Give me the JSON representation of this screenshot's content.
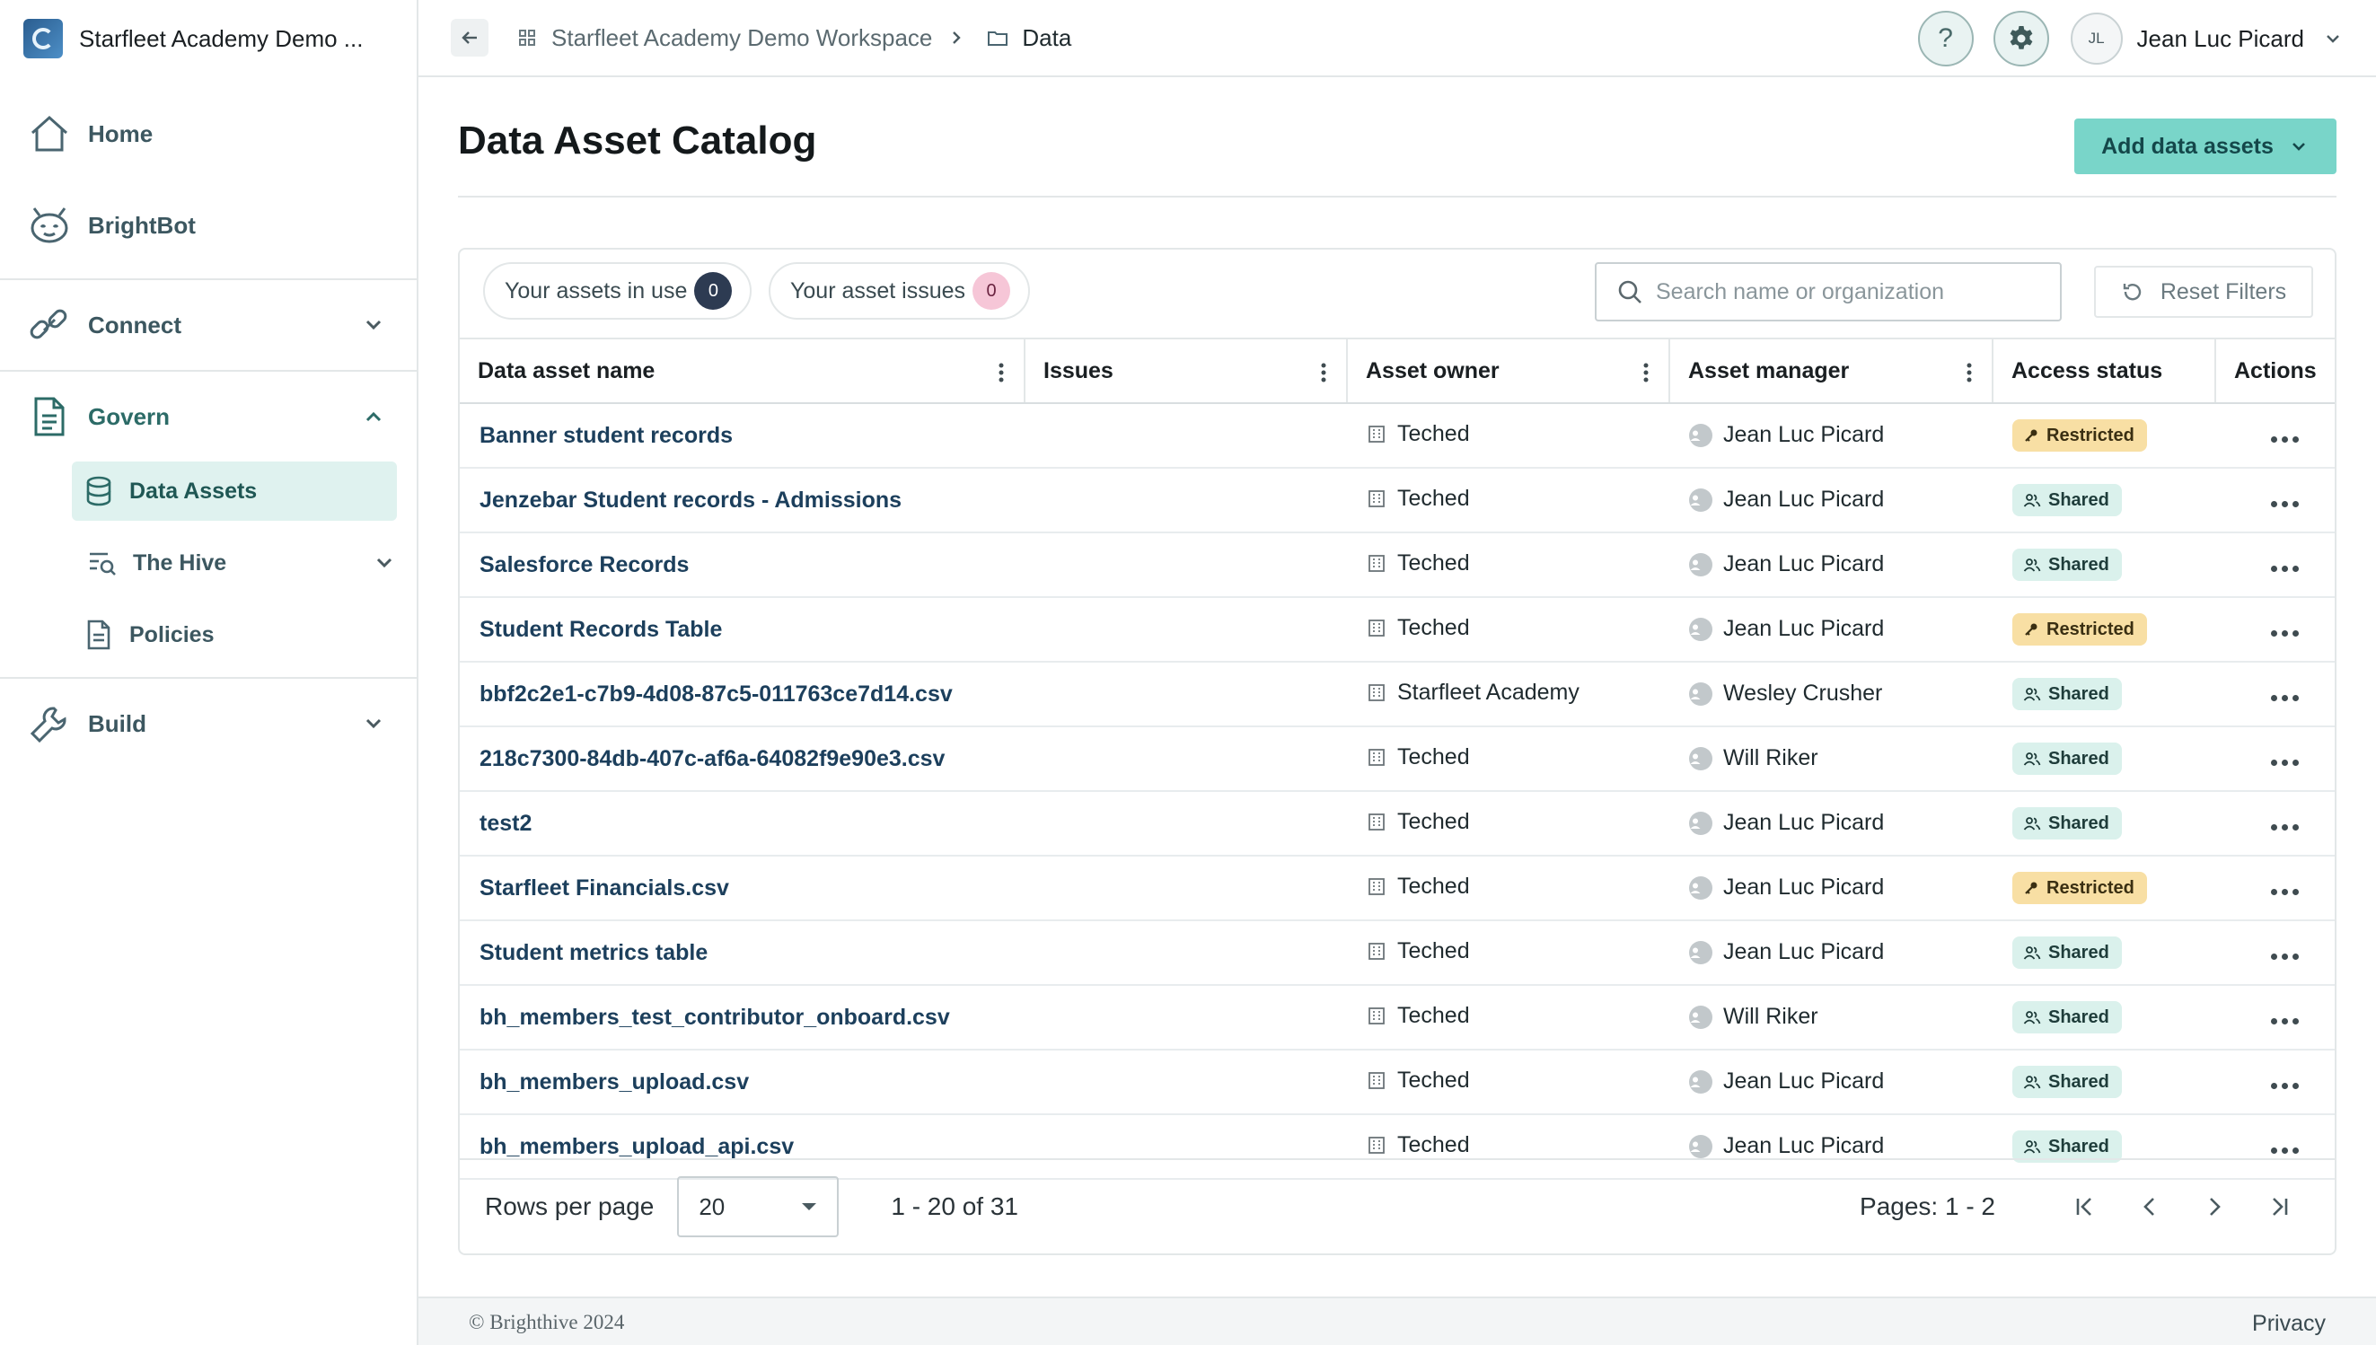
{
  "workspace": {
    "name": "Starfleet Academy Demo ..."
  },
  "sidebar": {
    "home": "Home",
    "brightbot": "BrightBot",
    "connect": "Connect",
    "govern": "Govern",
    "data_assets": "Data Assets",
    "hive": "The Hive",
    "policies": "Policies",
    "build": "Build"
  },
  "topbar": {
    "crumb_workspace": "Starfleet Academy Demo Workspace",
    "crumb_current": "Data",
    "help": "?",
    "user_initials": "JL",
    "user_name": "Jean Luc Picard"
  },
  "page": {
    "title": "Data Asset Catalog",
    "add_button": "Add data assets"
  },
  "filters": {
    "in_use_label": "Your assets in use",
    "in_use_count": "0",
    "issues_label": "Your asset issues",
    "issues_count": "0",
    "search_placeholder": "Search name or organization",
    "reset_label": "Reset Filters"
  },
  "table": {
    "headers": {
      "name": "Data asset name",
      "issues": "Issues",
      "owner": "Asset owner",
      "manager": "Asset manager",
      "status": "Access status",
      "actions": "Actions"
    },
    "rows": [
      {
        "name": "Banner student records",
        "issues": "",
        "owner": "Teched",
        "manager": "Jean Luc Picard",
        "status": "Restricted"
      },
      {
        "name": "Jenzebar Student records - Admissions",
        "issues": "",
        "owner": "Teched",
        "manager": "Jean Luc Picard",
        "status": "Shared"
      },
      {
        "name": "Salesforce Records",
        "issues": "",
        "owner": "Teched",
        "manager": "Jean Luc Picard",
        "status": "Shared"
      },
      {
        "name": "Student Records Table",
        "issues": "",
        "owner": "Teched",
        "manager": "Jean Luc Picard",
        "status": "Restricted"
      },
      {
        "name": "bbf2c2e1-c7b9-4d08-87c5-011763ce7d14.csv",
        "issues": "",
        "owner": "Starfleet Academy",
        "manager": "Wesley Crusher",
        "status": "Shared"
      },
      {
        "name": "218c7300-84db-407c-af6a-64082f9e90e3.csv",
        "issues": "",
        "owner": "Teched",
        "manager": "Will Riker",
        "status": "Shared"
      },
      {
        "name": "test2",
        "issues": "",
        "owner": "Teched",
        "manager": "Jean Luc Picard",
        "status": "Shared"
      },
      {
        "name": "Starfleet Financials.csv",
        "issues": "",
        "owner": "Teched",
        "manager": "Jean Luc Picard",
        "status": "Restricted"
      },
      {
        "name": "Student metrics table",
        "issues": "",
        "owner": "Teched",
        "manager": "Jean Luc Picard",
        "status": "Shared"
      },
      {
        "name": "bh_members_test_contributor_onboard.csv",
        "issues": "",
        "owner": "Teched",
        "manager": "Will Riker",
        "status": "Shared"
      },
      {
        "name": "bh_members_upload.csv",
        "issues": "",
        "owner": "Teched",
        "manager": "Jean Luc Picard",
        "status": "Shared"
      },
      {
        "name": "bh_members_upload_api.csv",
        "issues": "",
        "owner": "Teched",
        "manager": "Jean Luc Picard",
        "status": "Shared"
      }
    ]
  },
  "pagination": {
    "rows_per_page_label": "Rows per page",
    "rows_per_page": "20",
    "range": "1 - 20 of 31",
    "pages": "Pages: 1 - 2"
  },
  "footer": {
    "copyright": "© Brighthive 2024",
    "privacy": "Privacy"
  },
  "colors": {
    "accent": "#79d5c9",
    "restricted": "#f8dfa4",
    "shared": "#daf1ec",
    "link": "#1c3f5c"
  }
}
